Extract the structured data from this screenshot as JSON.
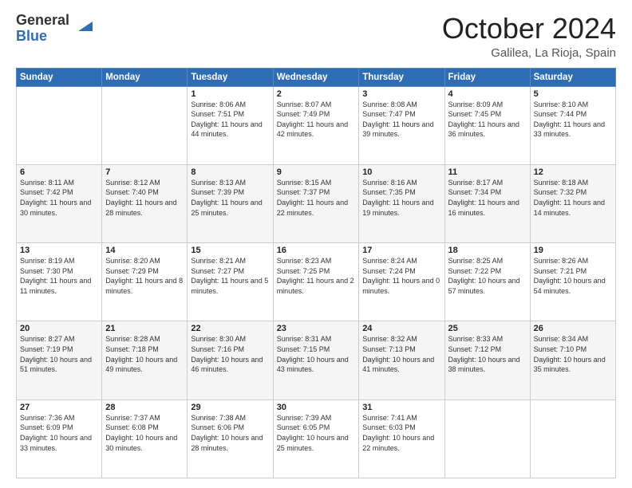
{
  "logo": {
    "line1": "General",
    "line2": "Blue"
  },
  "header": {
    "month": "October 2024",
    "location": "Galilea, La Rioja, Spain"
  },
  "weekdays": [
    "Sunday",
    "Monday",
    "Tuesday",
    "Wednesday",
    "Thursday",
    "Friday",
    "Saturday"
  ],
  "weeks": [
    [
      {
        "day": "",
        "info": ""
      },
      {
        "day": "",
        "info": ""
      },
      {
        "day": "1",
        "info": "Sunrise: 8:06 AM\nSunset: 7:51 PM\nDaylight: 11 hours and 44 minutes."
      },
      {
        "day": "2",
        "info": "Sunrise: 8:07 AM\nSunset: 7:49 PM\nDaylight: 11 hours and 42 minutes."
      },
      {
        "day": "3",
        "info": "Sunrise: 8:08 AM\nSunset: 7:47 PM\nDaylight: 11 hours and 39 minutes."
      },
      {
        "day": "4",
        "info": "Sunrise: 8:09 AM\nSunset: 7:45 PM\nDaylight: 11 hours and 36 minutes."
      },
      {
        "day": "5",
        "info": "Sunrise: 8:10 AM\nSunset: 7:44 PM\nDaylight: 11 hours and 33 minutes."
      }
    ],
    [
      {
        "day": "6",
        "info": "Sunrise: 8:11 AM\nSunset: 7:42 PM\nDaylight: 11 hours and 30 minutes."
      },
      {
        "day": "7",
        "info": "Sunrise: 8:12 AM\nSunset: 7:40 PM\nDaylight: 11 hours and 28 minutes."
      },
      {
        "day": "8",
        "info": "Sunrise: 8:13 AM\nSunset: 7:39 PM\nDaylight: 11 hours and 25 minutes."
      },
      {
        "day": "9",
        "info": "Sunrise: 8:15 AM\nSunset: 7:37 PM\nDaylight: 11 hours and 22 minutes."
      },
      {
        "day": "10",
        "info": "Sunrise: 8:16 AM\nSunset: 7:35 PM\nDaylight: 11 hours and 19 minutes."
      },
      {
        "day": "11",
        "info": "Sunrise: 8:17 AM\nSunset: 7:34 PM\nDaylight: 11 hours and 16 minutes."
      },
      {
        "day": "12",
        "info": "Sunrise: 8:18 AM\nSunset: 7:32 PM\nDaylight: 11 hours and 14 minutes."
      }
    ],
    [
      {
        "day": "13",
        "info": "Sunrise: 8:19 AM\nSunset: 7:30 PM\nDaylight: 11 hours and 11 minutes."
      },
      {
        "day": "14",
        "info": "Sunrise: 8:20 AM\nSunset: 7:29 PM\nDaylight: 11 hours and 8 minutes."
      },
      {
        "day": "15",
        "info": "Sunrise: 8:21 AM\nSunset: 7:27 PM\nDaylight: 11 hours and 5 minutes."
      },
      {
        "day": "16",
        "info": "Sunrise: 8:23 AM\nSunset: 7:25 PM\nDaylight: 11 hours and 2 minutes."
      },
      {
        "day": "17",
        "info": "Sunrise: 8:24 AM\nSunset: 7:24 PM\nDaylight: 11 hours and 0 minutes."
      },
      {
        "day": "18",
        "info": "Sunrise: 8:25 AM\nSunset: 7:22 PM\nDaylight: 10 hours and 57 minutes."
      },
      {
        "day": "19",
        "info": "Sunrise: 8:26 AM\nSunset: 7:21 PM\nDaylight: 10 hours and 54 minutes."
      }
    ],
    [
      {
        "day": "20",
        "info": "Sunrise: 8:27 AM\nSunset: 7:19 PM\nDaylight: 10 hours and 51 minutes."
      },
      {
        "day": "21",
        "info": "Sunrise: 8:28 AM\nSunset: 7:18 PM\nDaylight: 10 hours and 49 minutes."
      },
      {
        "day": "22",
        "info": "Sunrise: 8:30 AM\nSunset: 7:16 PM\nDaylight: 10 hours and 46 minutes."
      },
      {
        "day": "23",
        "info": "Sunrise: 8:31 AM\nSunset: 7:15 PM\nDaylight: 10 hours and 43 minutes."
      },
      {
        "day": "24",
        "info": "Sunrise: 8:32 AM\nSunset: 7:13 PM\nDaylight: 10 hours and 41 minutes."
      },
      {
        "day": "25",
        "info": "Sunrise: 8:33 AM\nSunset: 7:12 PM\nDaylight: 10 hours and 38 minutes."
      },
      {
        "day": "26",
        "info": "Sunrise: 8:34 AM\nSunset: 7:10 PM\nDaylight: 10 hours and 35 minutes."
      }
    ],
    [
      {
        "day": "27",
        "info": "Sunrise: 7:36 AM\nSunset: 6:09 PM\nDaylight: 10 hours and 33 minutes."
      },
      {
        "day": "28",
        "info": "Sunrise: 7:37 AM\nSunset: 6:08 PM\nDaylight: 10 hours and 30 minutes."
      },
      {
        "day": "29",
        "info": "Sunrise: 7:38 AM\nSunset: 6:06 PM\nDaylight: 10 hours and 28 minutes."
      },
      {
        "day": "30",
        "info": "Sunrise: 7:39 AM\nSunset: 6:05 PM\nDaylight: 10 hours and 25 minutes."
      },
      {
        "day": "31",
        "info": "Sunrise: 7:41 AM\nSunset: 6:03 PM\nDaylight: 10 hours and 22 minutes."
      },
      {
        "day": "",
        "info": ""
      },
      {
        "day": "",
        "info": ""
      }
    ]
  ]
}
